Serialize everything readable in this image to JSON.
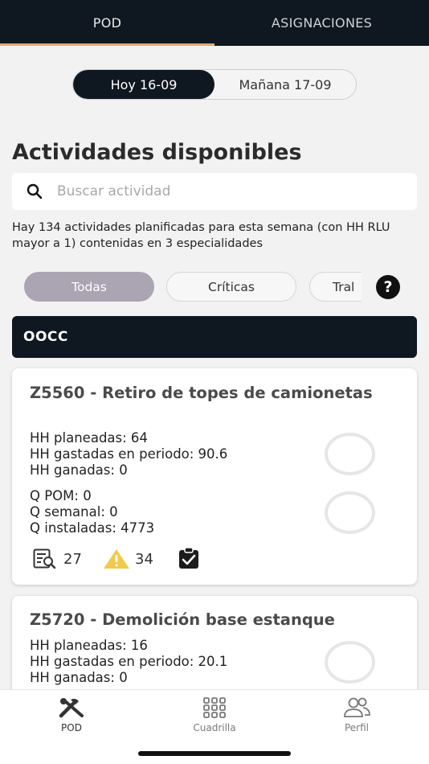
{
  "tabs": {
    "pod": "POD",
    "asignaciones": "ASIGNACIONES"
  },
  "days": {
    "today": "Hoy 16-09",
    "tomorrow": "Mañana 17-09"
  },
  "heading": "Actividades disponibles",
  "search": {
    "placeholder": "Buscar actividad",
    "value": ""
  },
  "summary": "Hay 134 actividades planificadas para esta semana (con HH RLU mayor a 1) contenidas en 3 especialidades",
  "filters": {
    "all": "Todas",
    "critical": "Críticas",
    "third": "Tral",
    "help": "?"
  },
  "section": "OOCC",
  "cards": [
    {
      "title": "Z5560 - Retiro de topes de camionetas",
      "hh_planned": "HH planeadas: 64",
      "hh_spent": "HH gastadas en periodo: 90.6",
      "hh_earned": "HH ganadas: 0",
      "q_pom": "Q POM: 0",
      "q_week": "Q semanal: 0",
      "q_installed": "Q instaladas: 4773",
      "inspections": "27",
      "warnings": "34"
    },
    {
      "title": "Z5720 - Demolición base estanque",
      "hh_planned": "HH planeadas: 16",
      "hh_spent": "HH gastadas en periodo: 20.1",
      "hh_earned": "HH ganadas: 0"
    }
  ],
  "nav": {
    "pod": "POD",
    "crew": "Cuadrilla",
    "profile": "Perfil"
  },
  "colors": {
    "dark": "#0f1720",
    "accent": "#e2a873",
    "chip_selected": "#aaa4b3",
    "warning": "#f2c94c"
  }
}
